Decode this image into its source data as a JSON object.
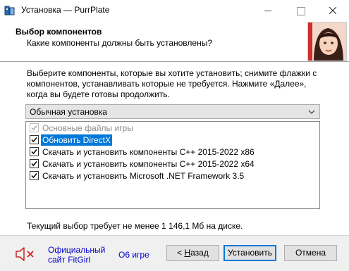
{
  "window": {
    "title": "Установка — PurrPlate"
  },
  "header": {
    "title": "Выбор компонентов",
    "subtitle": "Какие компоненты должны быть установлены?"
  },
  "main": {
    "description": "Выберите компоненты, которые вы хотите установить; снимите флажки с компонентов, устанавливать которые не требуется. Нажмите «Далее», когда вы будете готовы продолжить.",
    "install_type": "Обычная установка",
    "components": [
      {
        "label": "Основные файлы игры",
        "checked": true,
        "disabled": true,
        "selected": false
      },
      {
        "label": "Обновить DirectX",
        "checked": true,
        "disabled": false,
        "selected": true
      },
      {
        "label": "Скачать и установить компоненты C++ 2015-2022 x86",
        "checked": true,
        "disabled": false,
        "selected": false
      },
      {
        "label": "Скачать и установить компоненты C++ 2015-2022 x64",
        "checked": true,
        "disabled": false,
        "selected": false
      },
      {
        "label": "Скачать и установить Microsoft .NET Framework 3.5",
        "checked": true,
        "disabled": false,
        "selected": false
      }
    ],
    "space_required": "Текущий выбор требует не менее 1 146,1 Мб на диске."
  },
  "footer": {
    "site_link_line1": "Официальный",
    "site_link_line2": "сайт FitGirl",
    "about_link": "О6 игре",
    "back_button_prefix": "< ",
    "back_button_accel": "Н",
    "back_button_rest": "азад",
    "install_button": "Установить",
    "cancel_button": "Отмена"
  },
  "colors": {
    "accent": "#0078d7",
    "link": "#0000cc",
    "mute_icon": "#cc2222"
  }
}
